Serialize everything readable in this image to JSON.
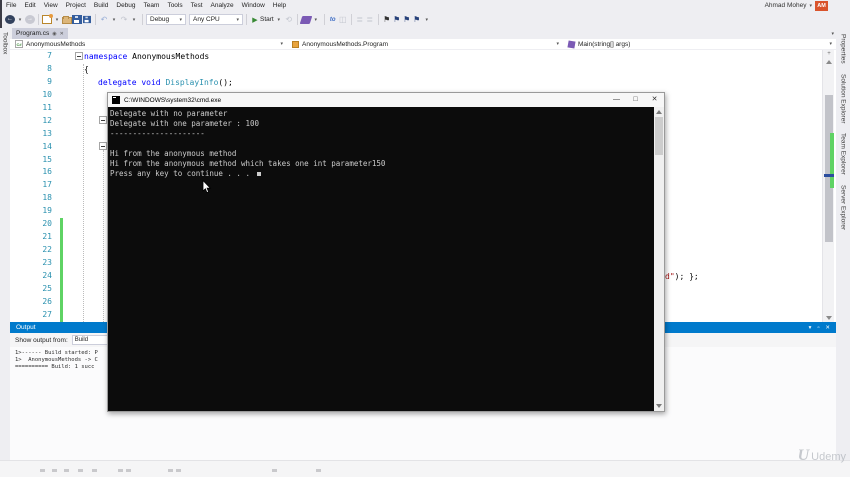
{
  "window": {
    "account_name": "Ahmad Mohey",
    "account_initials": "AM"
  },
  "menu": {
    "items": [
      "File",
      "Edit",
      "View",
      "Project",
      "Build",
      "Debug",
      "Team",
      "Tools",
      "Test",
      "Analyze",
      "Window",
      "Help"
    ]
  },
  "toolbar": {
    "debug_config": "Debug",
    "platform": "Any CPU",
    "start_label": "Start",
    "navigate_to_label": "to"
  },
  "tabs": {
    "active": "Program.cs"
  },
  "navbar": {
    "project": "AnonymousMethods",
    "type": "AnonymousMethods.Program",
    "member": "Main(string[] args)"
  },
  "panels": {
    "left": [
      "Toolbox"
    ],
    "right": [
      "Properties",
      "Solution Explorer",
      "Team Explorer",
      "Server Explorer"
    ]
  },
  "editor": {
    "line_numbers": [
      "7",
      "8",
      "9",
      "10",
      "11",
      "12",
      "13",
      "14",
      "15",
      "16",
      "17",
      "18",
      "19",
      "20",
      "21",
      "22",
      "23",
      "24",
      "25",
      "26",
      "27"
    ],
    "code": {
      "l7_kw": "namespace",
      "l7_name": " AnonymousMethods",
      "l8": "{",
      "l9_kw1": "delegate",
      "l9_kw2": " void",
      "l9_type": " DisplayInfo",
      "l9_tail": "();",
      "l24_str": "d\"",
      "l24_tail": "); };"
    }
  },
  "console": {
    "title": "C:\\WINDOWS\\system32\\cmd.exe",
    "lines": [
      "Delegate with no parameter",
      "Delegate with one parameter : 100",
      "---------------------",
      "",
      "Hi from the anonymous method",
      "Hi from the anonymous method which takes one int parameter150"
    ],
    "prompt": "Press any key to continue . . . "
  },
  "output": {
    "title": "Output",
    "filter_label": "Show output from:",
    "filter_value": "Build",
    "lines": [
      "1>------ Build started: P",
      "1>  AnonymousMethods -> C",
      "========== Build: 1 succ"
    ]
  },
  "watermark": {
    "brand": "Udemy",
    "logo": "U"
  },
  "colors": {
    "accent": "#007acc",
    "keyword": "#0000ff",
    "type_name": "#2b91af",
    "string_literal": "#a31515",
    "console_bg": "#0c0c0c",
    "change_bar_green": "#5fd364",
    "account_badge": "#d9532c"
  }
}
